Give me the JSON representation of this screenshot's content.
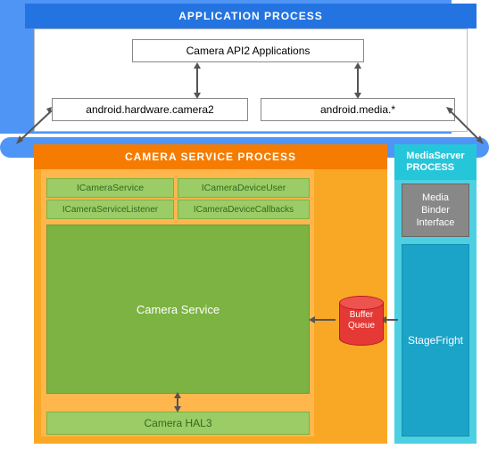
{
  "application_process": {
    "title": "APPLICATION PROCESS",
    "api2": "Camera API2 Applications",
    "hw_camera2": "android.hardware.camera2",
    "android_media": "android.media.*"
  },
  "camera_service_process": {
    "title": "CAMERA SERVICE PROCESS",
    "ifaces": {
      "icamera_service": "ICameraService",
      "icamera_device_user": "ICameraDeviceUser",
      "icamera_service_listener": "ICameraServiceListener",
      "icamera_device_callbacks": "ICameraDeviceCallbacks"
    },
    "camera_service": "Camera Service",
    "hal3": "Camera HAL3"
  },
  "mediaserver_process": {
    "title": "MediaServer\nPROCESS",
    "media_binder": "Media\nBinder\nInterface",
    "stagefright": "StageFright"
  },
  "buffer_queue": "Buffer\nQueue",
  "colors": {
    "app_blue": "#4f95f6",
    "app_title": "#2374e1",
    "orange": "#f9a825",
    "orange_dark": "#f57c00",
    "green_light": "#9ccc65",
    "green_dark": "#7cb342",
    "cyan": "#4dd0e1",
    "cyan_dark": "#26c6da",
    "gray": "#888888",
    "red": "#e53935"
  }
}
